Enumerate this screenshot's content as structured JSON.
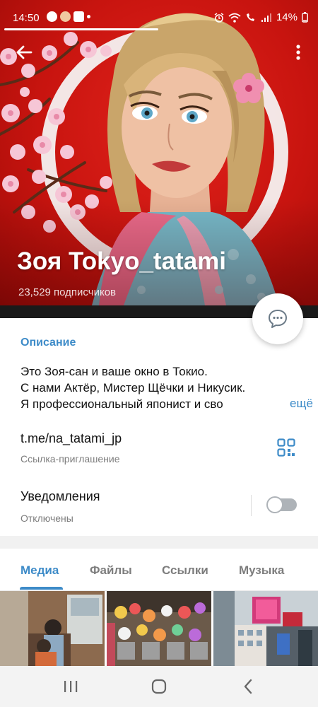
{
  "status_bar": {
    "time": "14:50",
    "battery": "14%",
    "icons": [
      "alarm-icon",
      "wifi-icon",
      "call-icon",
      "signal-icon",
      "battery-icon"
    ]
  },
  "header": {
    "channel_name": "Зоя Tokyo_tatami",
    "subscribers": "23,529 подписчиков",
    "background_color": "#c8140f",
    "back_icon": "arrow-left-icon",
    "more_icon": "more-vertical-icon",
    "fab_icon": "chat-bubble-icon"
  },
  "description": {
    "label": "Описание",
    "lines": [
      "Это Зоя-сан и ваше окно в Токио.",
      "С нами Актёр, Мистер Щёчки и Никусик.",
      "Я профессиональный японист и  сво"
    ],
    "more": "ещё"
  },
  "invite_link": {
    "value": "t.me/na_tatami_jp",
    "caption": "Ссылка-приглашение",
    "icon": "qr-code-icon"
  },
  "notifications": {
    "label": "Уведомления",
    "status": "Отключены",
    "enabled": false
  },
  "tabs": {
    "items": [
      {
        "label": "Медиа",
        "active": true
      },
      {
        "label": "Файлы",
        "active": false
      },
      {
        "label": "Ссылки",
        "active": false
      },
      {
        "label": "Музыка",
        "active": false
      }
    ]
  },
  "accent_color": "#3d8bc8",
  "navbar": {
    "icons": [
      "recent-apps-icon",
      "home-icon",
      "back-icon"
    ]
  }
}
